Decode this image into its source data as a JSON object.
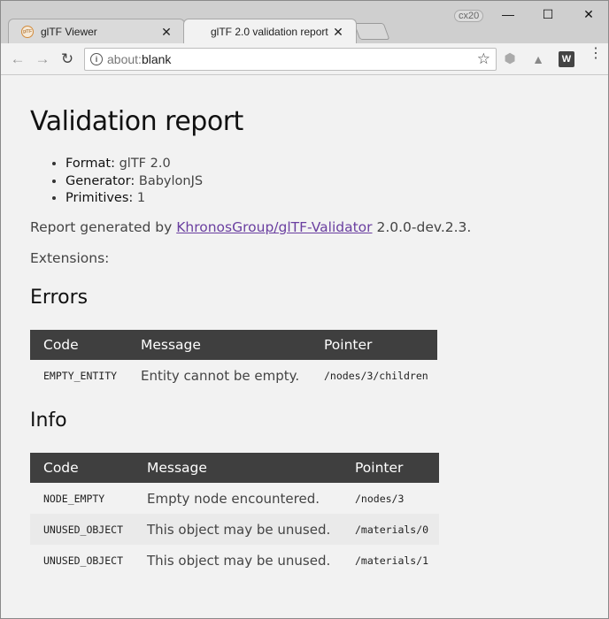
{
  "browser": {
    "tabs": [
      {
        "title": "glTF Viewer",
        "active": false
      },
      {
        "title": "glTF 2.0 validation report",
        "active": true
      }
    ],
    "favicon_text": "glTF",
    "user_badge": "cx20",
    "address": {
      "scheme": "about:",
      "host": "blank"
    },
    "icons": {
      "back": "←",
      "forward": "→",
      "reload": "↻",
      "star": "☆",
      "close": "✕",
      "minimize": "—",
      "maximize": "☐",
      "menu": "⋮",
      "ext3": "W"
    }
  },
  "report": {
    "title": "Validation report",
    "meta": [
      {
        "key": "Format:",
        "value": "glTF 2.0"
      },
      {
        "key": "Generator:",
        "value": "BabylonJS"
      },
      {
        "key": "Primitives:",
        "value": "1"
      }
    ],
    "generated_prefix": "Report generated by ",
    "generated_link": "KhronosGroup/glTF-Validator",
    "generated_suffix": " 2.0.0-dev.2.3.",
    "extensions_label": "Extensions:",
    "errors_heading": "Errors",
    "info_heading": "Info",
    "columns": [
      "Code",
      "Message",
      "Pointer"
    ],
    "errors": [
      {
        "code": "EMPTY_ENTITY",
        "message": "Entity cannot be empty.",
        "pointer": "/nodes/3/children"
      }
    ],
    "info": [
      {
        "code": "NODE_EMPTY",
        "message": "Empty node encountered.",
        "pointer": "/nodes/3"
      },
      {
        "code": "UNUSED_OBJECT",
        "message": "This object may be unused.",
        "pointer": "/materials/0"
      },
      {
        "code": "UNUSED_OBJECT",
        "message": "This object may be unused.",
        "pointer": "/materials/1"
      }
    ]
  }
}
